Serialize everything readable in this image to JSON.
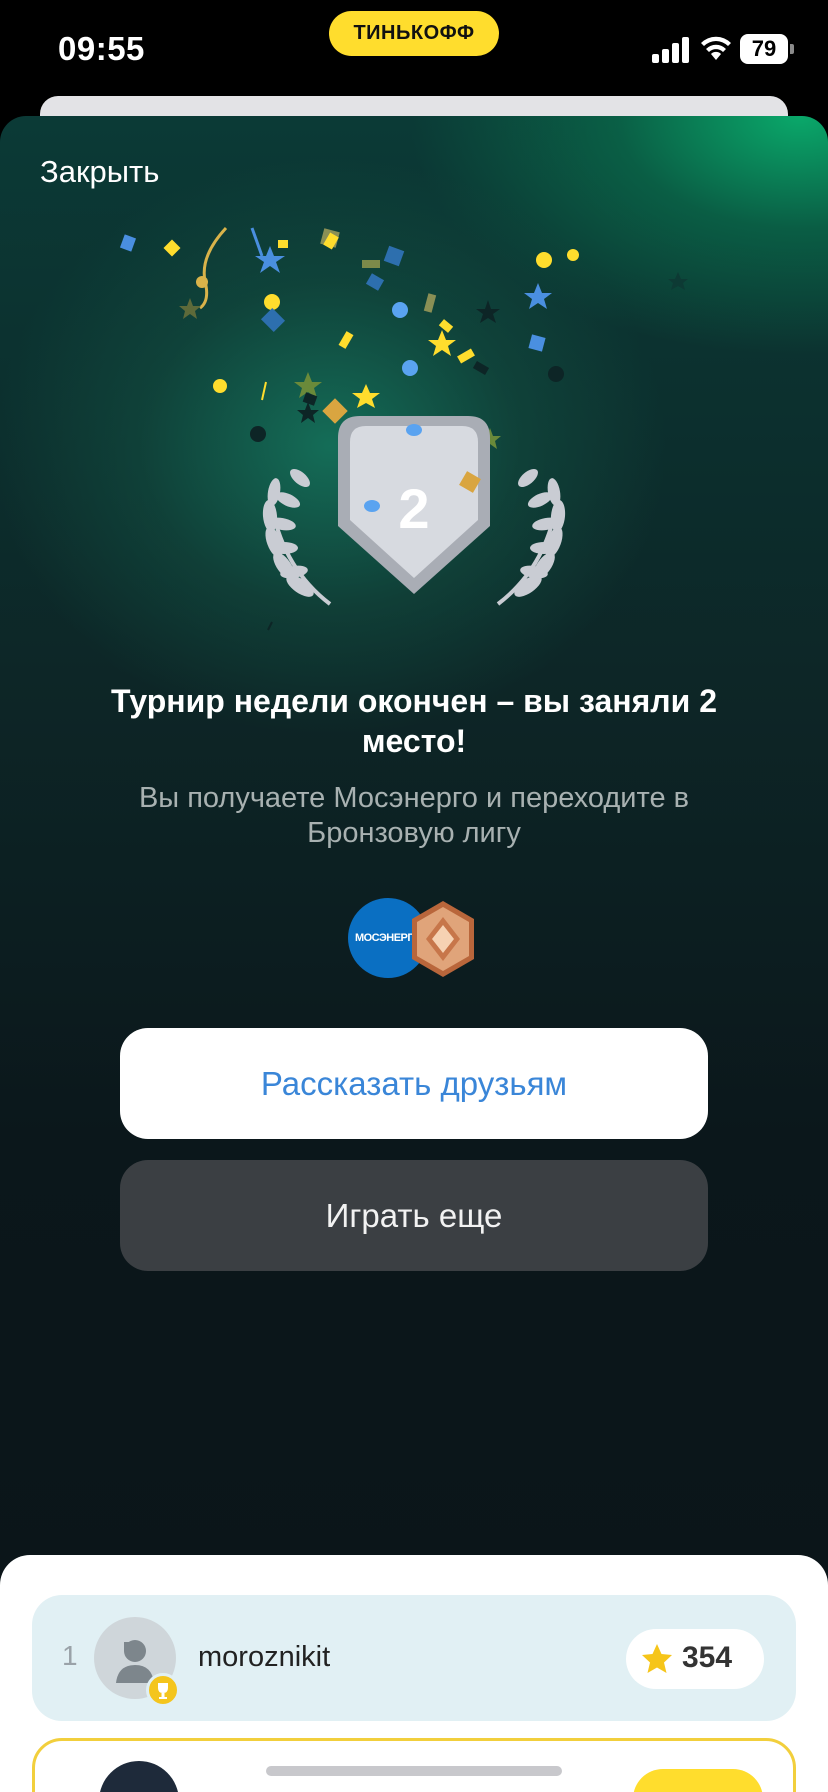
{
  "status_bar": {
    "time": "09:55",
    "brand": "ТИНЬКОФФ",
    "battery": "79",
    "icons": [
      "signal-icon",
      "wifi-icon",
      "battery-icon"
    ]
  },
  "modal": {
    "close_label": "Закрыть",
    "place_badge": "2",
    "title": "Турнир недели окончен – вы заняли 2 место!",
    "subtitle": "Вы получаете Мосэнерго и переходите в Бронзовую лигу",
    "reward_logo_text": "МОСЭНЕРГО",
    "share_button": "Рассказать друзьям",
    "play_button": "Играть еще"
  },
  "leaderboard": {
    "rows": [
      {
        "rank": "1",
        "username": "moroznikit",
        "score": "354"
      }
    ]
  },
  "colors": {
    "brand_yellow": "#ffdd2d",
    "share_text": "#3a86d8",
    "play_button_bg": "#3b3f43",
    "row_highlight": "#e1f0f4",
    "row_border_yellow": "#f2cf3c"
  }
}
